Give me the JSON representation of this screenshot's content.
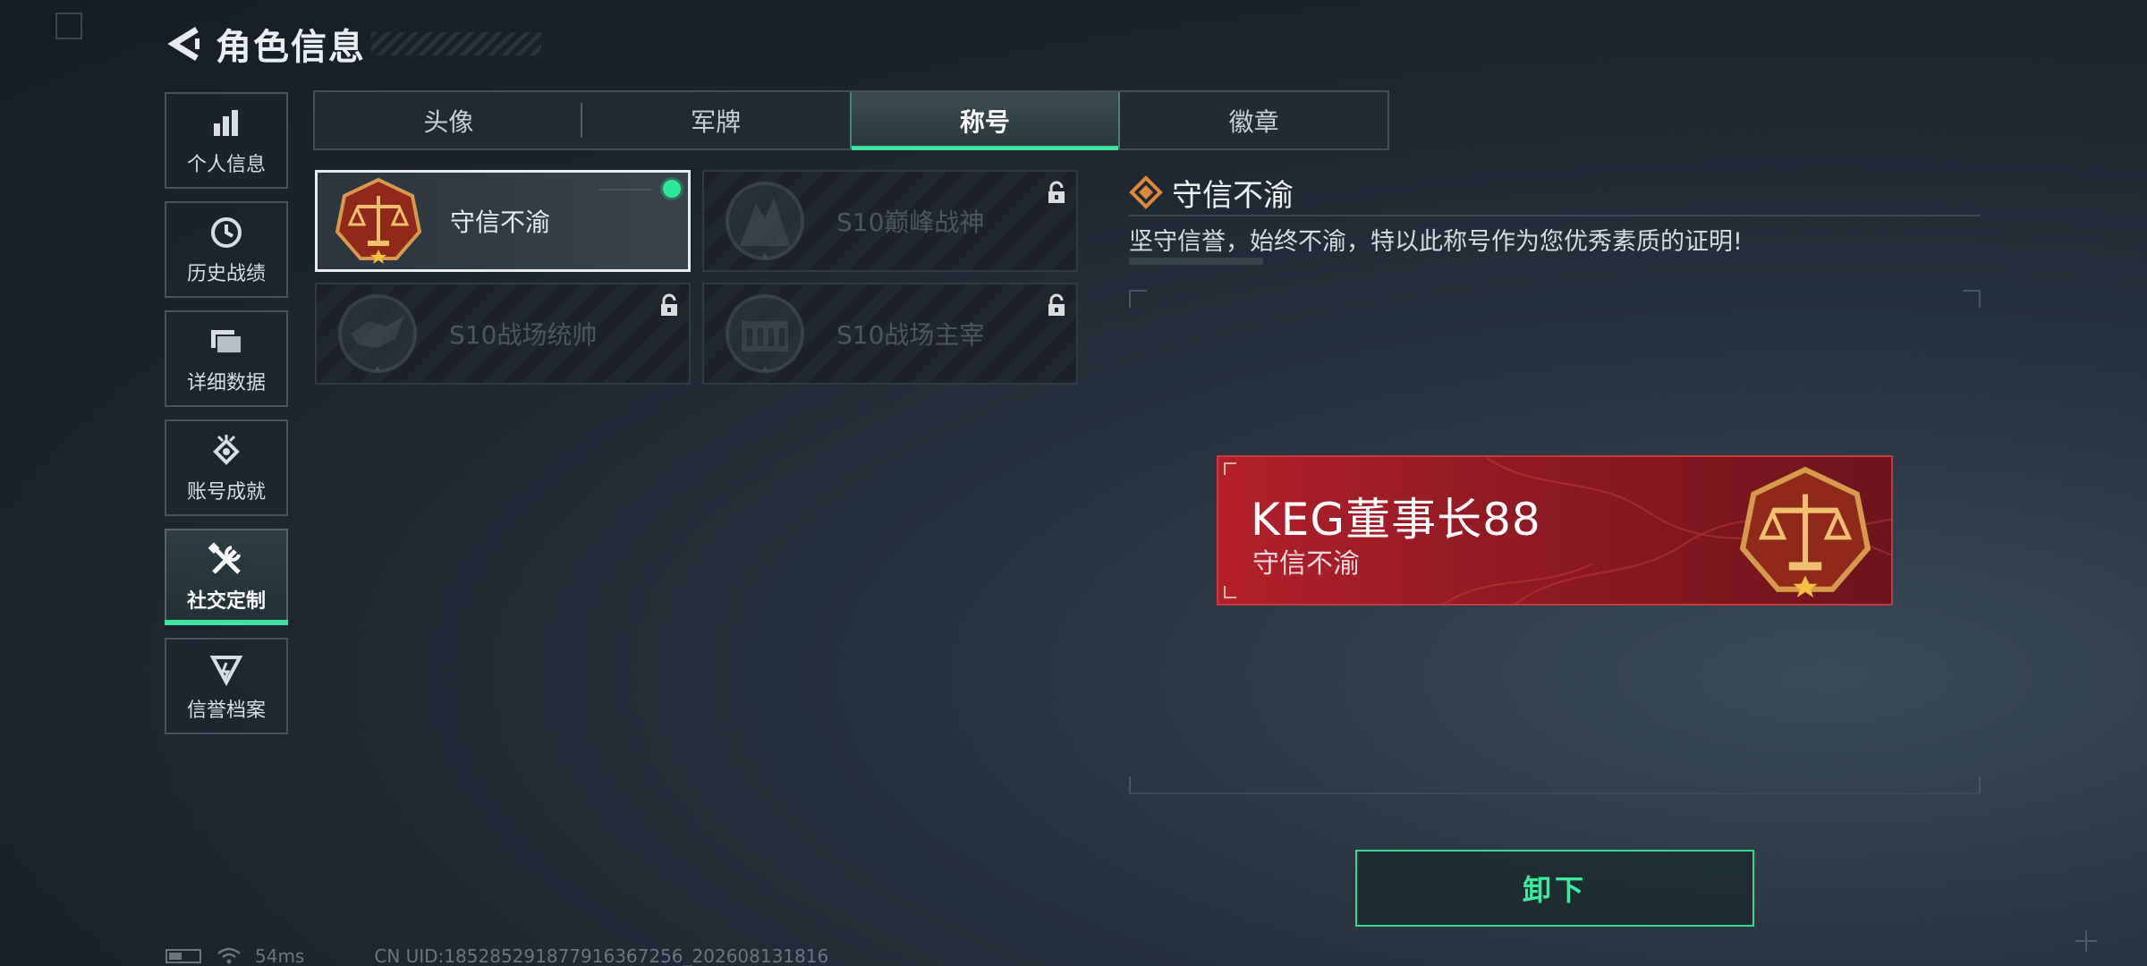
{
  "header": {
    "title": "角色信息"
  },
  "sidebar": {
    "items": [
      {
        "label": "个人信息",
        "icon": "bar-chart-icon"
      },
      {
        "label": "历史战绩",
        "icon": "history-clock-icon"
      },
      {
        "label": "详细数据",
        "icon": "folder-icon"
      },
      {
        "label": "账号成就",
        "icon": "achievement-icon"
      },
      {
        "label": "社交定制",
        "icon": "tools-icon",
        "active": true
      },
      {
        "label": "信誉档案",
        "icon": "reputation-icon"
      }
    ]
  },
  "tabs": [
    {
      "label": "头像"
    },
    {
      "label": "军牌"
    },
    {
      "label": "称号",
      "active": true
    },
    {
      "label": "徽章"
    }
  ],
  "cards": [
    {
      "name": "守信不渝",
      "state": "equipped",
      "emblem": "scales-emblem-icon"
    },
    {
      "name": "S10巅峰战神",
      "state": "locked",
      "emblem": "peak-emblem-icon"
    },
    {
      "name": "S10战场统帅",
      "state": "locked",
      "emblem": "commander-emblem-icon"
    },
    {
      "name": "S10战场主宰",
      "state": "locked",
      "emblem": "colosseum-emblem-icon"
    }
  ],
  "detail": {
    "name": "守信不渝",
    "description": "坚守信誉，始终不渝，特以此称号作为您优秀素质的证明!"
  },
  "nameplate": {
    "player_name": "KEG董事长88",
    "title": "守信不渝"
  },
  "actions": {
    "unequip_label": "卸下"
  },
  "status": {
    "ping": "54ms",
    "uid": "CN UID:1852852918779163672​56_202608131816"
  },
  "colors": {
    "accent": "#3fe0a0",
    "nameplate_red": "#b3202a",
    "equipped_dot": "#2ee89a"
  }
}
